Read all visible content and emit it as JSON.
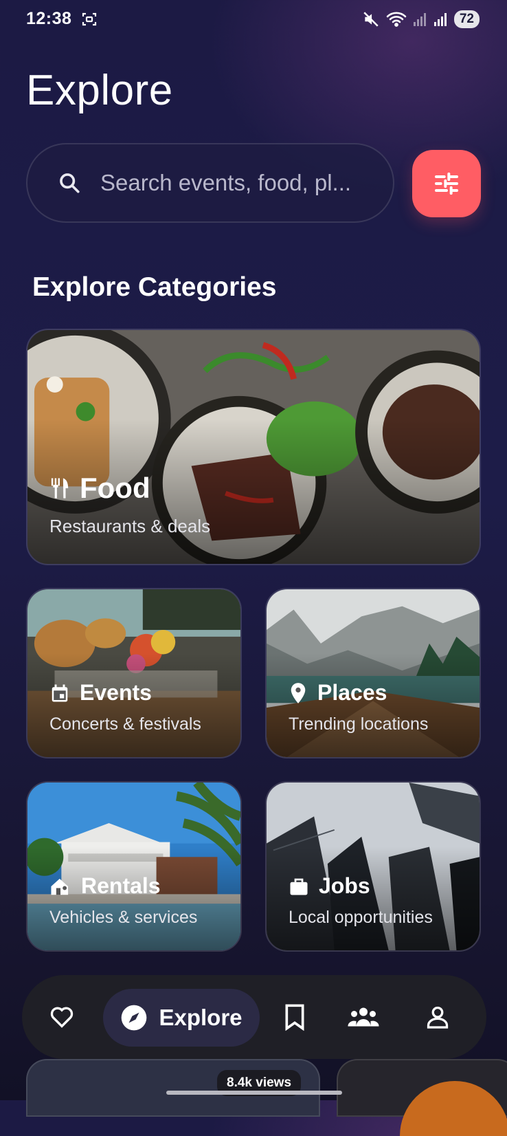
{
  "status_bar": {
    "time": "12:38",
    "battery": "72"
  },
  "page_title": "Explore",
  "search": {
    "placeholder": "Search events, food, pl..."
  },
  "section_title": "Explore Categories",
  "categories": [
    {
      "title": "Food",
      "subtitle": "Restaurants & deals",
      "icon": "restaurant-icon"
    },
    {
      "title": "Events",
      "subtitle": "Concerts & festivals",
      "icon": "calendar-icon"
    },
    {
      "title": "Places",
      "subtitle": "Trending locations",
      "icon": "location-pin-icon"
    },
    {
      "title": "Rentals",
      "subtitle": "Vehicles & services",
      "icon": "house-key-icon"
    },
    {
      "title": "Jobs",
      "subtitle": "Local opportunities",
      "icon": "briefcase-icon"
    }
  ],
  "nav": {
    "active_label": "Explore"
  },
  "peek": {
    "views": "8.4k views"
  },
  "colors": {
    "accent": "#ff5d64",
    "nav_bg": "#1f1f26",
    "nav_active_bg": "#2b2a45"
  }
}
